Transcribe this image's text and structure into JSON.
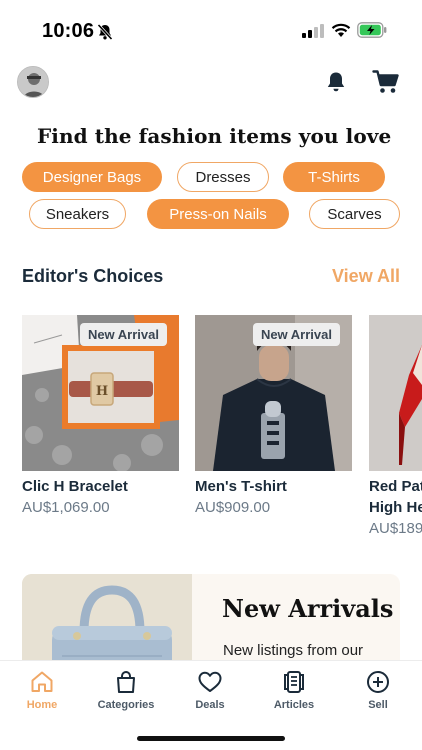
{
  "status_bar": {
    "time": "10:06"
  },
  "headline": "Find the fashion items you love",
  "chips": [
    {
      "label": "Designer Bags",
      "selected": true
    },
    {
      "label": "Dresses",
      "selected": false
    },
    {
      "label": "T-Shirts",
      "selected": true
    },
    {
      "label": "Sneakers",
      "selected": false
    },
    {
      "label": "Press-on Nails",
      "selected": true
    },
    {
      "label": "Scarves",
      "selected": false
    }
  ],
  "editors": {
    "title": "Editor's Choices",
    "view_all": "View All",
    "products": [
      {
        "badge": "New Arrival",
        "name": "Clic H Bracelet",
        "price": "AU$1,069.00"
      },
      {
        "badge": "New Arrival",
        "name": "Men's T-shirt",
        "price": "AU$909.00"
      },
      {
        "name_line1": "Red Pat",
        "name_line2": "High He",
        "price": "AU$189"
      }
    ]
  },
  "banner": {
    "title": "New Arrivals",
    "subtitle": "New listings from our"
  },
  "tabs": [
    {
      "label": "Home",
      "icon": "home-icon",
      "active": true
    },
    {
      "label": "Categories",
      "icon": "bag-icon",
      "active": false
    },
    {
      "label": "Deals",
      "icon": "heart-icon",
      "active": false
    },
    {
      "label": "Articles",
      "icon": "articles-icon",
      "active": false
    },
    {
      "label": "Sell",
      "icon": "plus-circle-icon",
      "active": false
    }
  ],
  "colors": {
    "accent": "#f39442",
    "accent_text": "#f0a765",
    "heading": "#1b2b3a"
  }
}
